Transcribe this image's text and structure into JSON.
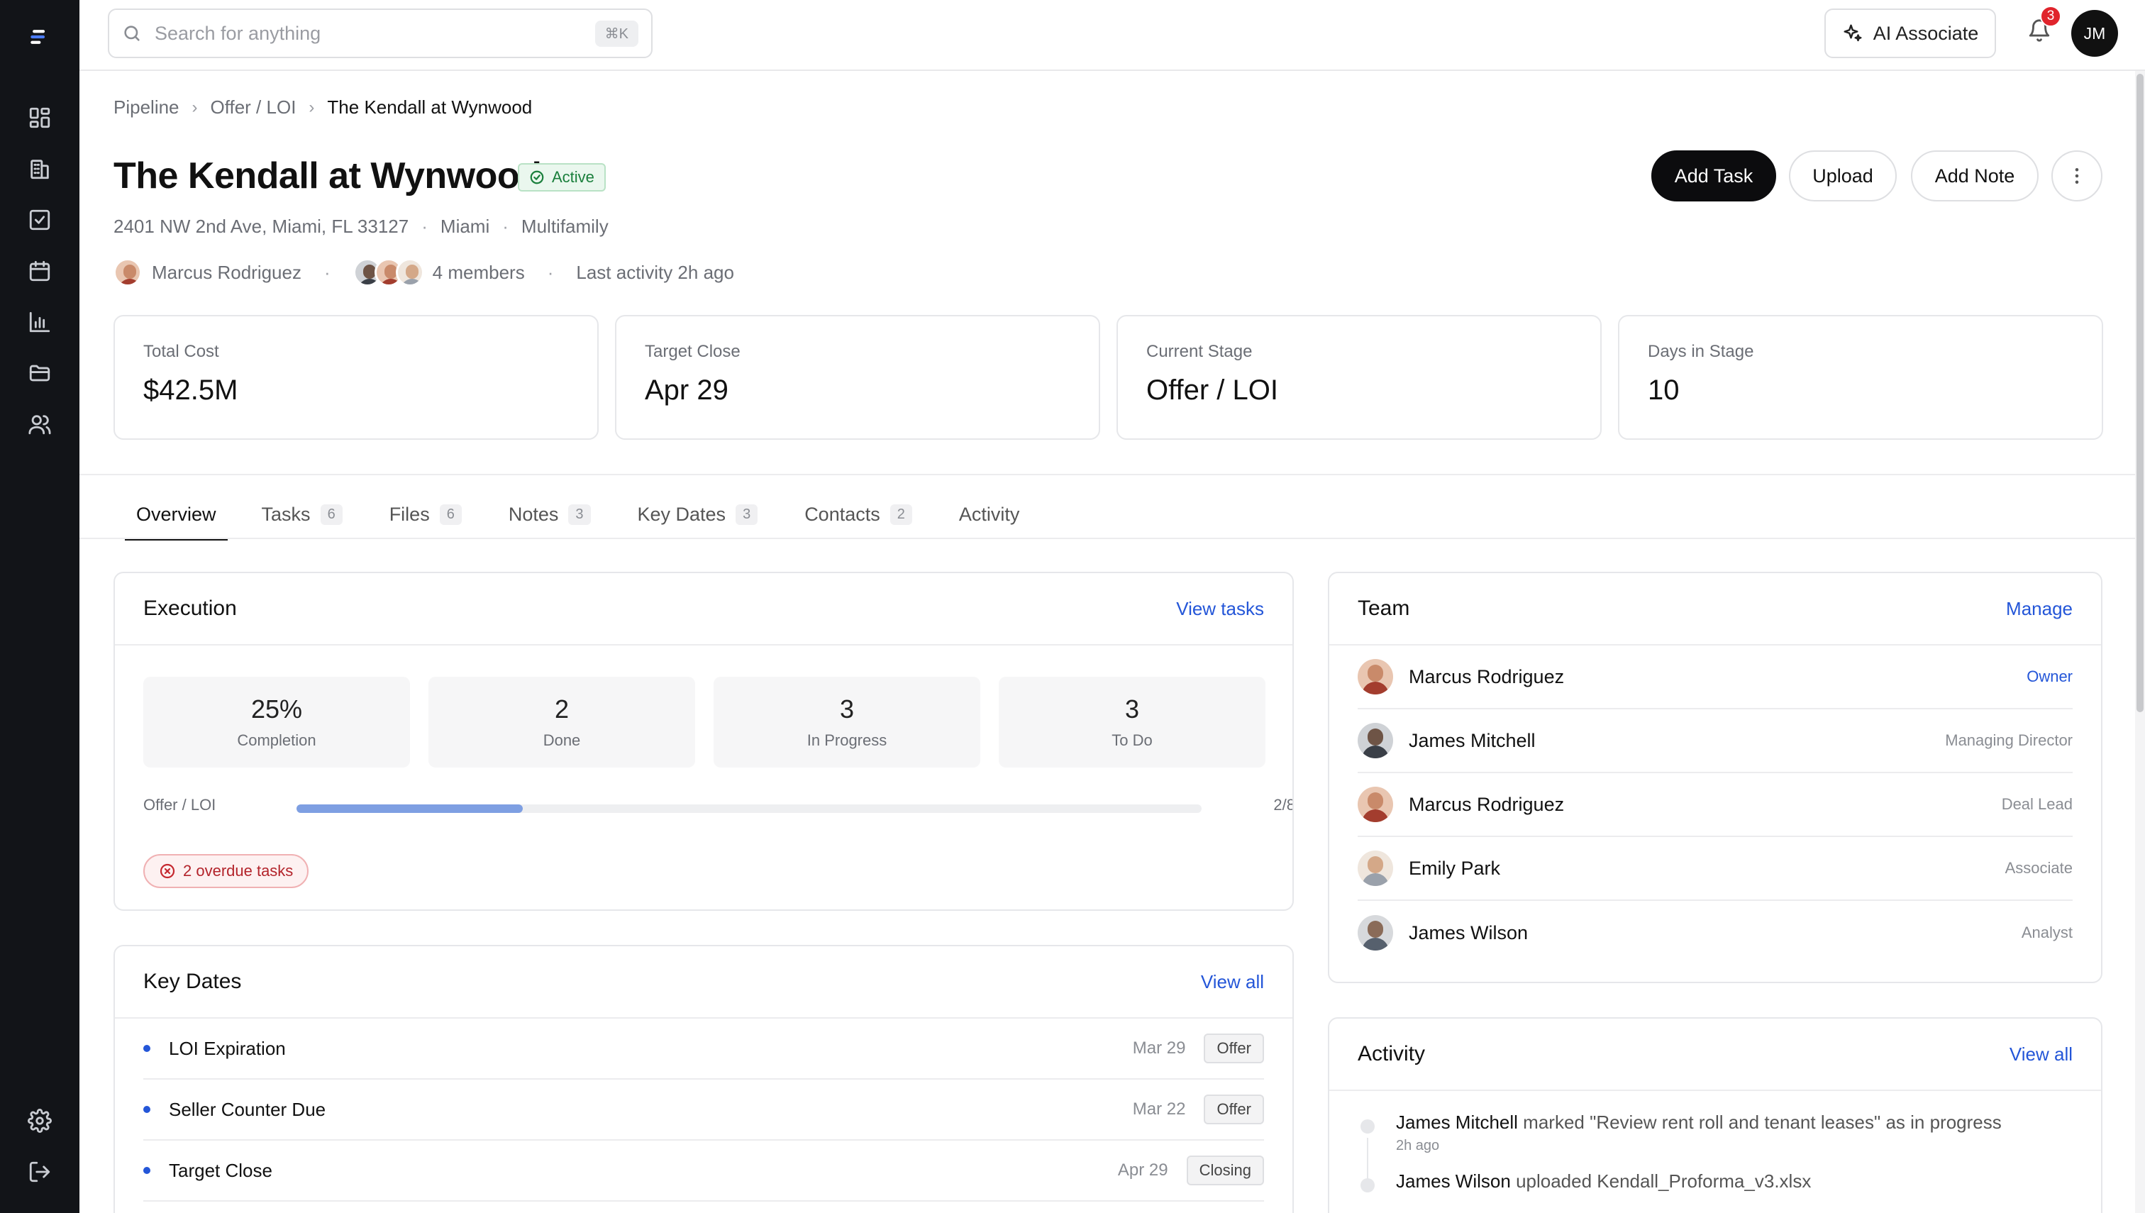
{
  "topbar": {
    "search_placeholder": "Search for anything",
    "search_shortcut": "⌘K",
    "ai_button": "AI Associate",
    "notification_count": "3",
    "user_initials": "JM"
  },
  "breadcrumb": [
    "Pipeline",
    "Offer / LOI",
    "The Kendall at Wynwood"
  ],
  "deal": {
    "title": "The Kendall at Wynwood",
    "status": "Active",
    "address": "2401 NW 2nd Ave, Miami, FL 33127",
    "market": "Miami",
    "asset_type": "Multifamily",
    "owner": "Marcus Rodriguez",
    "members": "4 members",
    "last_activity": "Last activity 2h ago"
  },
  "actions": {
    "add_task": "Add Task",
    "upload": "Upload",
    "add_note": "Add Note"
  },
  "stats": [
    {
      "label": "Total Cost",
      "value": "$42.5M"
    },
    {
      "label": "Target Close",
      "value": "Apr 29"
    },
    {
      "label": "Current Stage",
      "value": "Offer / LOI"
    },
    {
      "label": "Days in Stage",
      "value": "10"
    }
  ],
  "tabs": [
    {
      "label": "Overview",
      "count": ""
    },
    {
      "label": "Tasks",
      "count": "6"
    },
    {
      "label": "Files",
      "count": "6"
    },
    {
      "label": "Notes",
      "count": "3"
    },
    {
      "label": "Key Dates",
      "count": "3"
    },
    {
      "label": "Contacts",
      "count": "2"
    },
    {
      "label": "Activity",
      "count": ""
    }
  ],
  "execution": {
    "title": "Execution",
    "link": "View tasks",
    "tiles": [
      {
        "value": "25%",
        "label": "Completion"
      },
      {
        "value": "2",
        "label": "Done"
      },
      {
        "value": "3",
        "label": "In Progress"
      },
      {
        "value": "3",
        "label": "To Do"
      }
    ],
    "progress_label": "Offer / LOI",
    "progress_fraction": 0.25,
    "progress_count": "2/8",
    "overdue": "2 overdue tasks"
  },
  "key_dates": {
    "title": "Key Dates",
    "link": "View all",
    "items": [
      {
        "name": "LOI Expiration",
        "date": "Mar 29",
        "tag": "Offer"
      },
      {
        "name": "Seller Counter Due",
        "date": "Mar 22",
        "tag": "Offer"
      },
      {
        "name": "Target Close",
        "date": "Apr 29",
        "tag": "Closing"
      }
    ]
  },
  "team": {
    "title": "Team",
    "link": "Manage",
    "members": [
      {
        "name": "Marcus Rodriguez",
        "role": "Owner"
      },
      {
        "name": "James Mitchell",
        "role": "Managing Director"
      },
      {
        "name": "Marcus Rodriguez",
        "role": "Deal Lead"
      },
      {
        "name": "Emily Park",
        "role": "Associate"
      },
      {
        "name": "James Wilson",
        "role": "Analyst"
      }
    ]
  },
  "activity": {
    "title": "Activity",
    "link": "View all",
    "items": [
      {
        "who": "James Mitchell",
        "text": "marked \"Review rent roll and tenant leases\" as in progress",
        "time": "2h ago"
      },
      {
        "who": "James Wilson",
        "text": "uploaded Kendall_Proforma_v3.xlsx",
        "time": ""
      }
    ]
  },
  "colors": {
    "accent": "#2456d8",
    "sidebar": "#121418",
    "success": "#1a7f3c",
    "danger": "#c5282f",
    "progress": "#7e9fe2"
  }
}
